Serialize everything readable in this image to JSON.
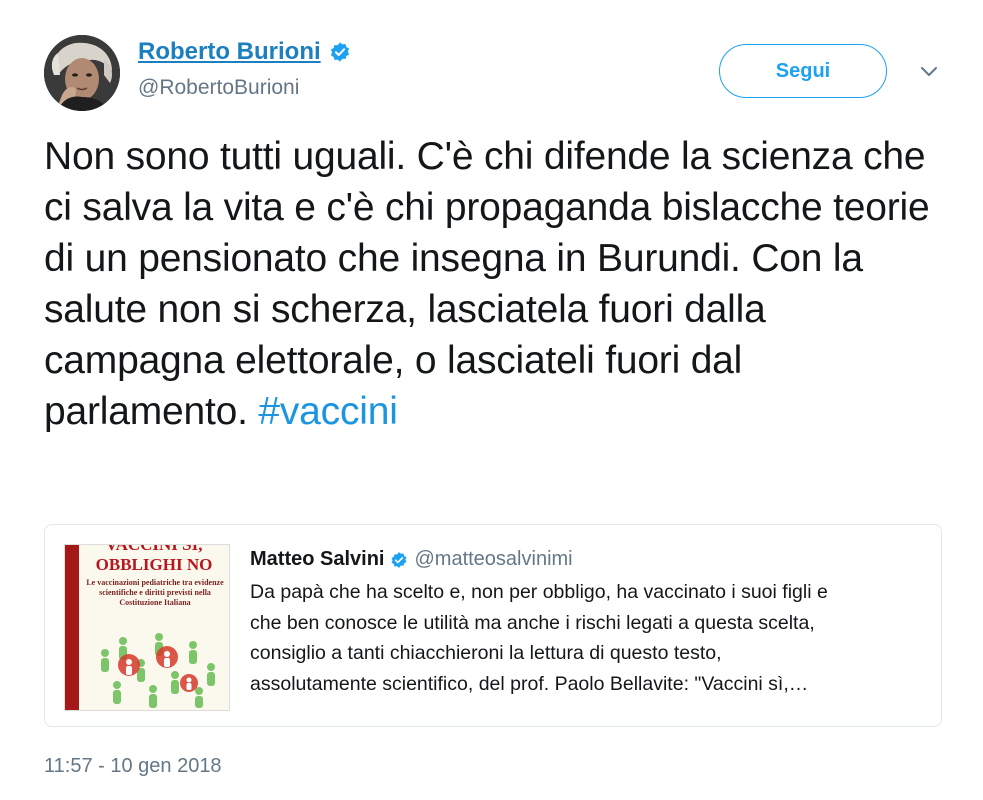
{
  "author": {
    "name": "Roberto Burioni",
    "handle": "@RobertoBurioni",
    "verified": true,
    "avatar_icon": "author-portrait"
  },
  "follow_button": {
    "label": "Segui"
  },
  "tweet": {
    "text": "Non sono tutti uguali. C'è chi difende la scienza che ci salva la vita e c'è chi propaganda bislacche teorie di un pensionato che insegna in Burundi. Con la salute non si scherza, lasciatela fuori dalla campagna elettorale, o lasciateli fuori dal parlamento. ",
    "hashtag": "#vaccini",
    "timestamp": "11:57 - 10 gen 2018"
  },
  "quoted_tweet": {
    "name": "Matteo Salvini",
    "handle": "@matteosalvinimi",
    "verified": true,
    "text_lines": [
      "Da papà che ha scelto e, non per obbligo, ha vaccinato i suoi figli e",
      "che ben conosce le utilità ma anche i rischi legati a questa scelta,",
      "consiglio a tanti chiacchieroni la lettura di questo testo,",
      "assolutamente scientifico, del prof. Paolo Bellavite: \"Vaccini sì,…"
    ],
    "media": {
      "title_top": "VACCINI SI,",
      "title_bottom": "OBBLIGHI NO",
      "subtitle": "Le vaccinazioni pediatriche tra evidenze scientifiche e diritti previsti nella Costituzione Italiana"
    }
  },
  "colors": {
    "accent": "#1da1f2",
    "link": "#1b95e0",
    "name_link": "#1b7fc0",
    "muted": "#657786",
    "text": "#14171a",
    "book_red": "#b8161f"
  }
}
